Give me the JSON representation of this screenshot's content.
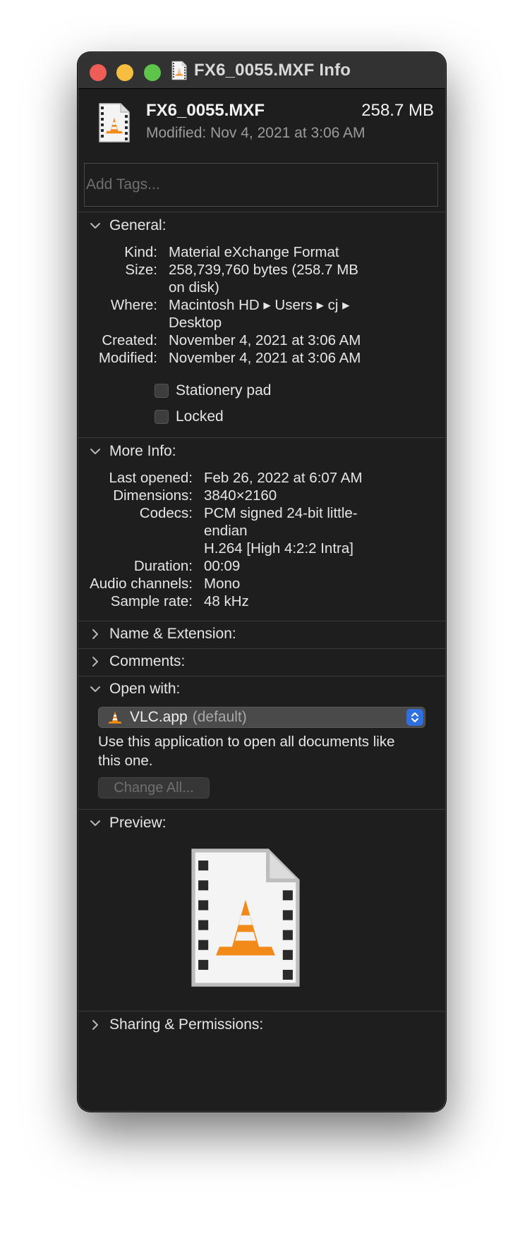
{
  "window": {
    "title": "FX6_0055.MXF Info"
  },
  "header": {
    "file_name": "FX6_0055.MXF",
    "file_size": "258.7 MB",
    "modified_label": "Modified:",
    "modified_value": "Nov 4, 2021 at 3:06 AM"
  },
  "tags": {
    "placeholder": "Add Tags..."
  },
  "general": {
    "title": "General:",
    "rows": [
      {
        "label": "Kind:",
        "value": "Material eXchange Format"
      },
      {
        "label": "Size:",
        "value": "258,739,760 bytes (258.7 MB",
        "value2": "on disk)"
      },
      {
        "label": "Where:",
        "value": "Macintosh HD ▸ Users ▸ cj ▸",
        "value2": "Desktop"
      },
      {
        "label": "Created:",
        "value": "November 4, 2021 at 3:06 AM"
      },
      {
        "label": "Modified:",
        "value": "November 4, 2021 at 3:06 AM"
      }
    ],
    "stationery_label": "Stationery pad",
    "locked_label": "Locked"
  },
  "more_info": {
    "title": "More Info:",
    "rows": [
      {
        "label": "Last opened:",
        "value": "Feb 26, 2022 at 6:07 AM"
      },
      {
        "label": "Dimensions:",
        "value": "3840×2160"
      },
      {
        "label": "Codecs:",
        "value": "PCM signed 24-bit little-",
        "value2": "endian",
        "value3": "H.264 [High 4:2:2 Intra]"
      },
      {
        "label": "Duration:",
        "value": "00:09"
      },
      {
        "label": "Audio channels:",
        "value": "Mono"
      },
      {
        "label": "Sample rate:",
        "value": "48 kHz"
      }
    ]
  },
  "name_extension": {
    "title": "Name & Extension:"
  },
  "comments": {
    "title": "Comments:"
  },
  "open_with": {
    "title": "Open with:",
    "app": "VLC.app",
    "default_tag": "(default)",
    "description": "Use this application to open all documents like this one.",
    "change_all_label": "Change All..."
  },
  "preview": {
    "title": "Preview:"
  },
  "sharing": {
    "title": "Sharing & Permissions:"
  },
  "colors": {
    "window_bg": "#1e1e1e",
    "titlebar_bg": "#323232",
    "close": "#ee5e57",
    "minimize": "#f5be3e",
    "zoom": "#5ec44a",
    "accent": "#2f6fe0",
    "vlc_orange": "#f08a1c"
  },
  "icons": {
    "file": "vlc-document-icon",
    "disclosure_open": "chevron-down-icon",
    "disclosure_closed": "chevron-right-icon",
    "popup": "up-down-arrows-icon"
  }
}
